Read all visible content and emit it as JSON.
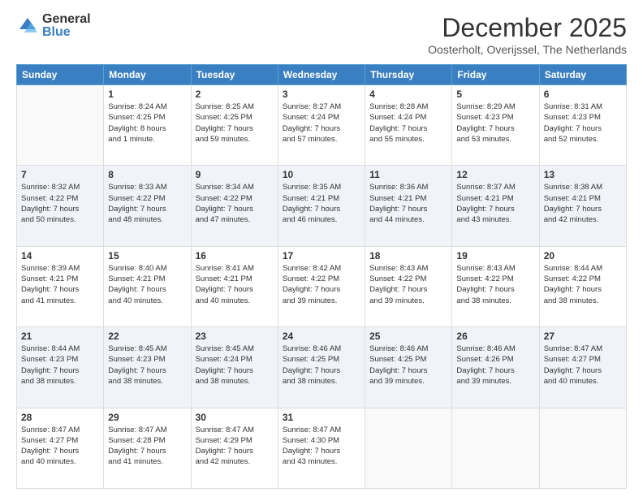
{
  "logo": {
    "general": "General",
    "blue": "Blue"
  },
  "header": {
    "month": "December 2025",
    "location": "Oosterholt, Overijssel, The Netherlands"
  },
  "weekdays": [
    "Sunday",
    "Monday",
    "Tuesday",
    "Wednesday",
    "Thursday",
    "Friday",
    "Saturday"
  ],
  "weeks": [
    [
      {
        "day": "",
        "info": ""
      },
      {
        "day": "1",
        "info": "Sunrise: 8:24 AM\nSunset: 4:25 PM\nDaylight: 8 hours\nand 1 minute."
      },
      {
        "day": "2",
        "info": "Sunrise: 8:25 AM\nSunset: 4:25 PM\nDaylight: 7 hours\nand 59 minutes."
      },
      {
        "day": "3",
        "info": "Sunrise: 8:27 AM\nSunset: 4:24 PM\nDaylight: 7 hours\nand 57 minutes."
      },
      {
        "day": "4",
        "info": "Sunrise: 8:28 AM\nSunset: 4:24 PM\nDaylight: 7 hours\nand 55 minutes."
      },
      {
        "day": "5",
        "info": "Sunrise: 8:29 AM\nSunset: 4:23 PM\nDaylight: 7 hours\nand 53 minutes."
      },
      {
        "day": "6",
        "info": "Sunrise: 8:31 AM\nSunset: 4:23 PM\nDaylight: 7 hours\nand 52 minutes."
      }
    ],
    [
      {
        "day": "7",
        "info": "Sunrise: 8:32 AM\nSunset: 4:22 PM\nDaylight: 7 hours\nand 50 minutes."
      },
      {
        "day": "8",
        "info": "Sunrise: 8:33 AM\nSunset: 4:22 PM\nDaylight: 7 hours\nand 48 minutes."
      },
      {
        "day": "9",
        "info": "Sunrise: 8:34 AM\nSunset: 4:22 PM\nDaylight: 7 hours\nand 47 minutes."
      },
      {
        "day": "10",
        "info": "Sunrise: 8:35 AM\nSunset: 4:21 PM\nDaylight: 7 hours\nand 46 minutes."
      },
      {
        "day": "11",
        "info": "Sunrise: 8:36 AM\nSunset: 4:21 PM\nDaylight: 7 hours\nand 44 minutes."
      },
      {
        "day": "12",
        "info": "Sunrise: 8:37 AM\nSunset: 4:21 PM\nDaylight: 7 hours\nand 43 minutes."
      },
      {
        "day": "13",
        "info": "Sunrise: 8:38 AM\nSunset: 4:21 PM\nDaylight: 7 hours\nand 42 minutes."
      }
    ],
    [
      {
        "day": "14",
        "info": "Sunrise: 8:39 AM\nSunset: 4:21 PM\nDaylight: 7 hours\nand 41 minutes."
      },
      {
        "day": "15",
        "info": "Sunrise: 8:40 AM\nSunset: 4:21 PM\nDaylight: 7 hours\nand 40 minutes."
      },
      {
        "day": "16",
        "info": "Sunrise: 8:41 AM\nSunset: 4:21 PM\nDaylight: 7 hours\nand 40 minutes."
      },
      {
        "day": "17",
        "info": "Sunrise: 8:42 AM\nSunset: 4:22 PM\nDaylight: 7 hours\nand 39 minutes."
      },
      {
        "day": "18",
        "info": "Sunrise: 8:43 AM\nSunset: 4:22 PM\nDaylight: 7 hours\nand 39 minutes."
      },
      {
        "day": "19",
        "info": "Sunrise: 8:43 AM\nSunset: 4:22 PM\nDaylight: 7 hours\nand 38 minutes."
      },
      {
        "day": "20",
        "info": "Sunrise: 8:44 AM\nSunset: 4:22 PM\nDaylight: 7 hours\nand 38 minutes."
      }
    ],
    [
      {
        "day": "21",
        "info": "Sunrise: 8:44 AM\nSunset: 4:23 PM\nDaylight: 7 hours\nand 38 minutes."
      },
      {
        "day": "22",
        "info": "Sunrise: 8:45 AM\nSunset: 4:23 PM\nDaylight: 7 hours\nand 38 minutes."
      },
      {
        "day": "23",
        "info": "Sunrise: 8:45 AM\nSunset: 4:24 PM\nDaylight: 7 hours\nand 38 minutes."
      },
      {
        "day": "24",
        "info": "Sunrise: 8:46 AM\nSunset: 4:25 PM\nDaylight: 7 hours\nand 38 minutes."
      },
      {
        "day": "25",
        "info": "Sunrise: 8:46 AM\nSunset: 4:25 PM\nDaylight: 7 hours\nand 39 minutes."
      },
      {
        "day": "26",
        "info": "Sunrise: 8:46 AM\nSunset: 4:26 PM\nDaylight: 7 hours\nand 39 minutes."
      },
      {
        "day": "27",
        "info": "Sunrise: 8:47 AM\nSunset: 4:27 PM\nDaylight: 7 hours\nand 40 minutes."
      }
    ],
    [
      {
        "day": "28",
        "info": "Sunrise: 8:47 AM\nSunset: 4:27 PM\nDaylight: 7 hours\nand 40 minutes."
      },
      {
        "day": "29",
        "info": "Sunrise: 8:47 AM\nSunset: 4:28 PM\nDaylight: 7 hours\nand 41 minutes."
      },
      {
        "day": "30",
        "info": "Sunrise: 8:47 AM\nSunset: 4:29 PM\nDaylight: 7 hours\nand 42 minutes."
      },
      {
        "day": "31",
        "info": "Sunrise: 8:47 AM\nSunset: 4:30 PM\nDaylight: 7 hours\nand 43 minutes."
      },
      {
        "day": "",
        "info": ""
      },
      {
        "day": "",
        "info": ""
      },
      {
        "day": "",
        "info": ""
      }
    ]
  ]
}
